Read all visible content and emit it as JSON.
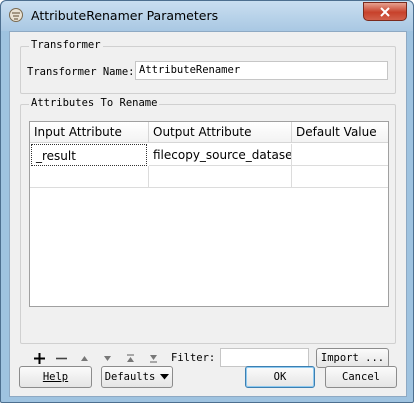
{
  "window": {
    "title": "AttributeRenamer Parameters"
  },
  "transformer_group": {
    "title": "Transformer",
    "name_label": "Transformer Name:",
    "name_value": "AttributeRenamer"
  },
  "attributes_group": {
    "title": "Attributes To Rename",
    "columns": [
      "Input Attribute",
      "Output Attribute",
      "Default Value"
    ],
    "rows": [
      {
        "input": "_result",
        "output": "filecopy_source_dataset",
        "default": ""
      },
      {
        "input": "",
        "output": "",
        "default": ""
      }
    ]
  },
  "toolbar": {
    "add_icon": "plus-icon",
    "remove_icon": "minus-icon",
    "filter_label": "Filter:",
    "filter_value": "",
    "import_label": "Import ..."
  },
  "buttons": {
    "help": "Help",
    "defaults": "Defaults",
    "ok": "OK",
    "cancel": "Cancel"
  }
}
